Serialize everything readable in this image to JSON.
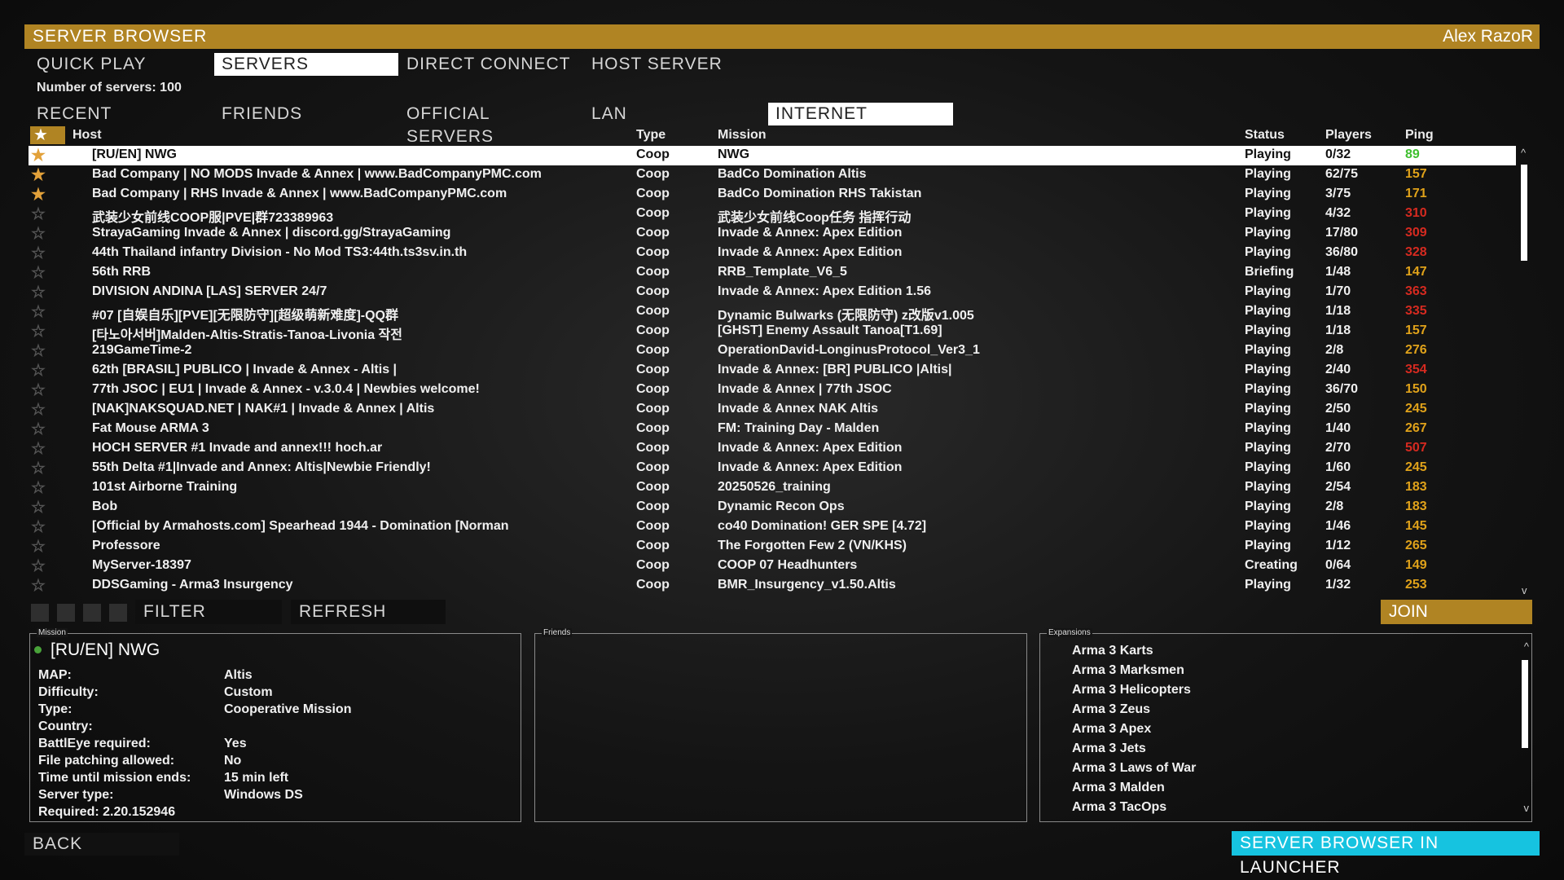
{
  "title": "SERVER BROWSER",
  "user": "Alex RazoR",
  "tabs": [
    "QUICK PLAY",
    "SERVERS",
    "DIRECT CONNECT",
    "HOST SERVER"
  ],
  "server_count": "Number of servers: 100",
  "subtabs": [
    "RECENT",
    "FRIENDS",
    "OFFICIAL SERVERS",
    "LAN",
    "INTERNET"
  ],
  "columns": {
    "host": "Host",
    "type": "Type",
    "mission": "Mission",
    "status": "Status",
    "players": "Players",
    "ping": "Ping"
  },
  "colors": {
    "accent": "#b08423",
    "ping_good": "#3fbf2f",
    "ping_mid": "#e0a21a",
    "ping_bad": "#d62a20",
    "launcher": "#16c3e0"
  },
  "servers": [
    {
      "fav": true,
      "icon": "shield",
      "host": "[RU/EN] NWG",
      "type": "Coop",
      "mission": "NWG",
      "status": "Playing",
      "players": "0/32",
      "ping": "89",
      "ping_level": "good",
      "selected": true
    },
    {
      "fav": true,
      "icon": "dot",
      "host": "Bad Company | NO MODS Invade & Annex | www.BadCompanyPMC.com",
      "type": "Coop",
      "mission": "BadCo Domination Altis",
      "status": "Playing",
      "players": "62/75",
      "ping": "157",
      "ping_level": "mid"
    },
    {
      "fav": true,
      "icon": "shield",
      "host": "Bad Company | RHS Invade & Annex | www.BadCompanyPMC.com",
      "type": "Coop",
      "mission": "BadCo Domination RHS Takistan",
      "status": "Playing",
      "players": "3/75",
      "ping": "171",
      "ping_level": "mid"
    },
    {
      "fav": false,
      "icon": "key",
      "host": "武装少女前线COOP服|PVE|群723389963",
      "type": "Coop",
      "mission": "武装少女前线Coop任务 指挥行动",
      "status": "Playing",
      "players": "4/32",
      "ping": "310",
      "ping_level": "bad"
    },
    {
      "fav": false,
      "icon": "shield",
      "host": "StrayaGaming Invade & Annex | discord.gg/StrayaGaming",
      "type": "Coop",
      "mission": "Invade & Annex: Apex Edition",
      "status": "Playing",
      "players": "17/80",
      "ping": "309",
      "ping_level": "bad"
    },
    {
      "fav": false,
      "icon": "shield",
      "host": "44th Thailand infantry Division - No Mod TS3:44th.ts3sv.in.th",
      "type": "Coop",
      "mission": "Invade & Annex: Apex Edition",
      "status": "Playing",
      "players": "36/80",
      "ping": "328",
      "ping_level": "bad"
    },
    {
      "fav": false,
      "icon": "key",
      "host": "56th RRB",
      "type": "Coop",
      "mission": "RRB_Template_V6_5",
      "status": "Briefing",
      "players": "1/48",
      "ping": "147",
      "ping_level": "mid"
    },
    {
      "fav": false,
      "icon": "shield",
      "host": "DIVISION ANDINA [LAS] SERVER 24/7",
      "type": "Coop",
      "mission": "Invade & Annex: Apex Edition 1.56",
      "status": "Playing",
      "players": "1/70",
      "ping": "363",
      "ping_level": "bad"
    },
    {
      "fav": false,
      "icon": "shield",
      "host": "#07 [自娱自乐][PVE][无限防守][超级萌新难度]-QQ群",
      "type": "Coop",
      "mission": "Dynamic Bulwarks (无限防守) z改版v1.005",
      "status": "Playing",
      "players": "1/18",
      "ping": "335",
      "ping_level": "bad"
    },
    {
      "fav": false,
      "icon": "shield",
      "host": "[타노아서버]Malden-Altis-Stratis-Tanoa-Livonia 작전",
      "type": "Coop",
      "mission": "[GHST] Enemy Assault Tanoa[T1.69]",
      "status": "Playing",
      "players": "1/18",
      "ping": "157",
      "ping_level": "mid"
    },
    {
      "fav": false,
      "icon": "key",
      "host": "219GameTime-2",
      "type": "Coop",
      "mission": "OperationDavid-LonginusProtocol_Ver3_1",
      "status": "Playing",
      "players": "2/8",
      "ping": "276",
      "ping_level": "mid"
    },
    {
      "fav": false,
      "icon": "shield",
      "host": "62th [BRASIL] PUBLICO | Invade & Annex - Altis |",
      "type": "Coop",
      "mission": "Invade & Annex: [BR] PUBLICO |Altis|",
      "status": "Playing",
      "players": "2/40",
      "ping": "354",
      "ping_level": "bad"
    },
    {
      "fav": false,
      "icon": "shield",
      "host": "77th JSOC | EU1 | Invade & Annex - v.3.0.4 | Newbies welcome!",
      "type": "Coop",
      "mission": "Invade & Annex | 77th JSOC",
      "status": "Playing",
      "players": "36/70",
      "ping": "150",
      "ping_level": "mid"
    },
    {
      "fav": false,
      "icon": "shield",
      "host": "[NAK]NAKSQUAD.NET | NAK#1 | Invade & Annex | Altis",
      "type": "Coop",
      "mission": "Invade & Annex NAK Altis",
      "status": "Playing",
      "players": "2/50",
      "ping": "245",
      "ping_level": "mid"
    },
    {
      "fav": false,
      "icon": "key",
      "host": "Fat Mouse ARMA 3",
      "type": "Coop",
      "mission": "FM: Training Day - Malden",
      "status": "Playing",
      "players": "1/40",
      "ping": "267",
      "ping_level": "mid"
    },
    {
      "fav": false,
      "icon": "shield",
      "host": "HOCH SERVER #1 Invade and annex!!! hoch.ar",
      "type": "Coop",
      "mission": "Invade & Annex: Apex Edition",
      "status": "Playing",
      "players": "2/70",
      "ping": "507",
      "ping_level": "bad"
    },
    {
      "fav": false,
      "icon": "shield",
      "host": "55th Delta #1|Invade and Annex: Altis|Newbie Friendly!",
      "type": "Coop",
      "mission": "Invade & Annex: Apex Edition",
      "status": "Playing",
      "players": "1/60",
      "ping": "245",
      "ping_level": "mid"
    },
    {
      "fav": false,
      "icon": "key",
      "host": "101st Airborne Training",
      "type": "Coop",
      "mission": "20250526_training",
      "status": "Playing",
      "players": "2/54",
      "ping": "183",
      "ping_level": "mid"
    },
    {
      "fav": false,
      "icon": "key",
      "host": "Bob",
      "type": "Coop",
      "mission": "Dynamic Recon Ops",
      "status": "Playing",
      "players": "2/8",
      "ping": "183",
      "ping_level": "mid"
    },
    {
      "fav": false,
      "icon": "shield",
      "host": "[Official by Armahosts.com] Spearhead 1944 - Domination [Norman",
      "type": "Coop",
      "mission": "co40 Domination! GER SPE [4.72]",
      "status": "Playing",
      "players": "1/46",
      "ping": "145",
      "ping_level": "mid"
    },
    {
      "fav": false,
      "icon": "dot",
      "host": "Professore",
      "type": "Coop",
      "mission": "The Forgotten Few 2 (VN/KHS)",
      "status": "Playing",
      "players": "1/12",
      "ping": "265",
      "ping_level": "mid"
    },
    {
      "fav": false,
      "icon": "key",
      "host": "MyServer-18397",
      "type": "Coop",
      "mission": "COOP 07 Headhunters",
      "status": "Creating",
      "players": "0/64",
      "ping": "149",
      "ping_level": "mid"
    },
    {
      "fav": false,
      "icon": "shield",
      "host": "DDSGaming - Arma3 Insurgency",
      "type": "Coop",
      "mission": "BMR_Insurgency_v1.50.Altis",
      "status": "Playing",
      "players": "1/32",
      "ping": "253",
      "ping_level": "mid"
    }
  ],
  "actions": {
    "filter": "FILTER",
    "refresh": "REFRESH",
    "join": "JOIN",
    "back": "BACK",
    "launcher": "SERVER BROWSER IN LAUNCHER"
  },
  "mission_panel": {
    "label": "Mission",
    "name": "[RU/EN] NWG",
    "fields": [
      {
        "k": "MAP:",
        "v": "Altis"
      },
      {
        "k": "Difficulty:",
        "v": "Custom"
      },
      {
        "k": "Type:",
        "v": "Cooperative Mission"
      },
      {
        "k": "Country:",
        "v": ""
      },
      {
        "k": "BattlEye required:",
        "v": "Yes"
      },
      {
        "k": "File patching allowed:",
        "v": "No"
      },
      {
        "k": "Time until mission ends:",
        "v": "15 min left"
      },
      {
        "k": "Server type:",
        "v": "Windows DS"
      },
      {
        "k": "Required: 2.20.152946",
        "v": ""
      }
    ]
  },
  "friends_panel": {
    "label": "Friends"
  },
  "expansions_panel": {
    "label": "Expansions",
    "items": [
      "Arma 3 Karts",
      "Arma 3 Marksmen",
      "Arma 3 Helicopters",
      "Arma 3 Zeus",
      "Arma 3 Apex",
      "Arma 3 Jets",
      "Arma 3 Laws of War",
      "Arma 3 Malden",
      "Arma 3 TacOps"
    ]
  }
}
